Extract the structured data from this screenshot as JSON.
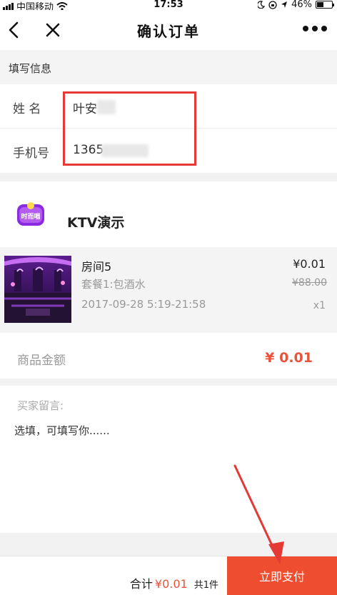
{
  "status_bar": {
    "carrier": "中国移动",
    "time": "17:53",
    "battery_percent": "46%",
    "battery_level": 0.46
  },
  "nav": {
    "title": "确认订单"
  },
  "section": {
    "title": "填写信息"
  },
  "form": {
    "name_label": "姓 名",
    "name_value": "叶安",
    "phone_label": "手机号",
    "phone_value": "1365"
  },
  "shop": {
    "name": "KTV演示",
    "logo_text": "时而唱"
  },
  "product": {
    "name": "房间5",
    "package": "套餐1:包酒水",
    "date": "2017-09-28 5:19-21:58",
    "price": "¥0.01",
    "original_price": "¥88.00",
    "quantity": "x1"
  },
  "amount": {
    "label": "商品金额",
    "value": "¥ 0.01"
  },
  "remark": {
    "label": "买家留言:",
    "placeholder": "选填，可填写你......"
  },
  "footer": {
    "total_label": "合计",
    "total_value": "¥0.01",
    "count_text": "共1件",
    "pay_button": "立即支付"
  },
  "colors": {
    "accent": "#ee4d2f",
    "price_red": "#e8533a",
    "annotation_red": "#e53935"
  }
}
